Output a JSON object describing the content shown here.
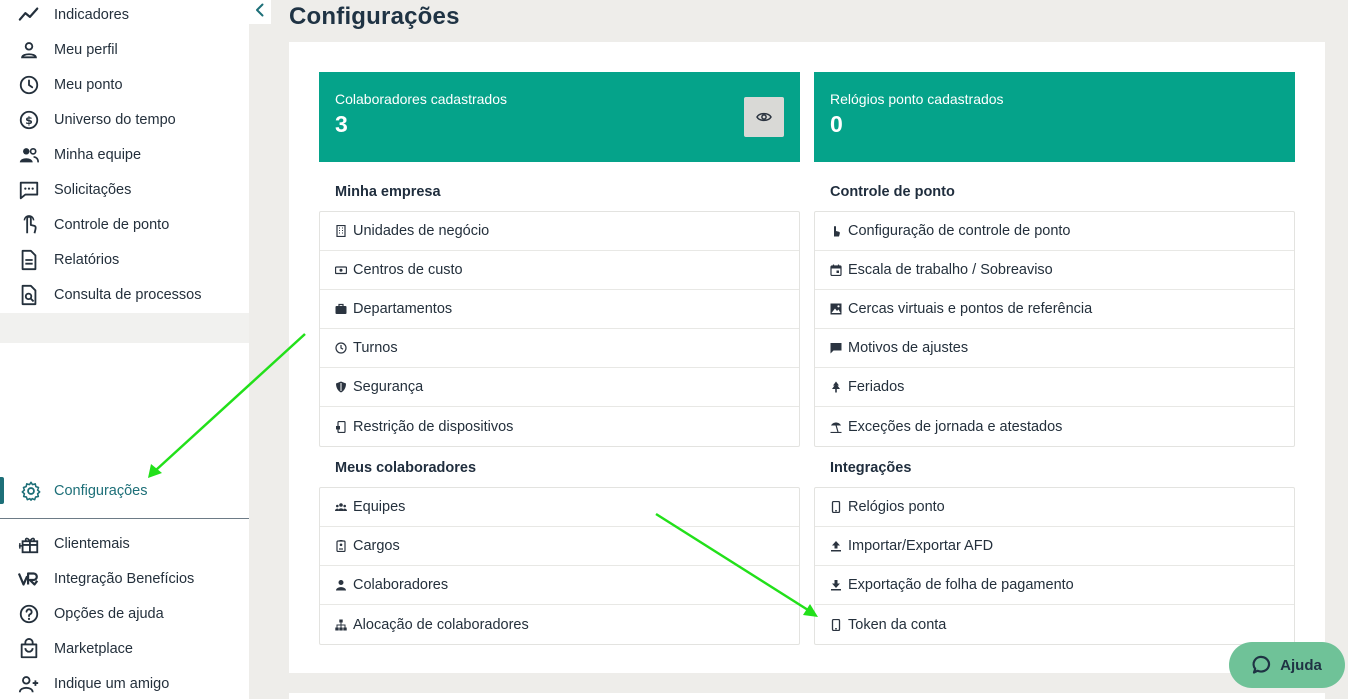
{
  "sidebar": {
    "items": [
      {
        "label": "Indicadores",
        "icon": "trend-icon"
      },
      {
        "label": "Meu perfil",
        "icon": "person-icon"
      },
      {
        "label": "Meu ponto",
        "icon": "clock-icon"
      },
      {
        "label": "Universo do tempo",
        "icon": "dollar-icon"
      },
      {
        "label": "Minha equipe",
        "icon": "team-icon"
      },
      {
        "label": "Solicitações",
        "icon": "chat-icon"
      },
      {
        "label": "Controle de ponto",
        "icon": "touch-icon"
      },
      {
        "label": "Relatórios",
        "icon": "document-icon"
      },
      {
        "label": "Consulta de processos",
        "icon": "search-document-icon"
      }
    ],
    "active_item": {
      "label": "Configurações",
      "icon": "gear-icon"
    },
    "bottom_items": [
      {
        "label": "Clientemais",
        "icon": "gift-icon"
      },
      {
        "label": "Integração Benefícios",
        "icon": "vr-icon"
      },
      {
        "label": "Opções de ajuda",
        "icon": "help-icon"
      },
      {
        "label": "Marketplace",
        "icon": "bag-icon"
      },
      {
        "label": "Indique um amigo",
        "icon": "add-person-icon"
      }
    ]
  },
  "page": {
    "title": "Configurações"
  },
  "stats": {
    "collaborators": {
      "label": "Colaboradores cadastrados",
      "value": "3"
    },
    "clocks": {
      "label": "Relógios ponto cadastrados",
      "value": "0"
    }
  },
  "sections": {
    "company": {
      "title": "Minha empresa",
      "items": [
        {
          "label": "Unidades de negócio",
          "icon": "building-icon"
        },
        {
          "label": "Centros de custo",
          "icon": "money-icon"
        },
        {
          "label": "Departamentos",
          "icon": "briefcase-icon"
        },
        {
          "label": "Turnos",
          "icon": "clock-icon"
        },
        {
          "label": "Segurança",
          "icon": "shield-icon"
        },
        {
          "label": "Restrição de dispositivos",
          "icon": "device-lock-icon"
        }
      ]
    },
    "timekeeping": {
      "title": "Controle de ponto",
      "items": [
        {
          "label": "Configuração de controle de ponto",
          "icon": "hand-pointer-icon"
        },
        {
          "label": "Escala de trabalho / Sobreaviso",
          "icon": "calendar-icon"
        },
        {
          "label": "Cercas virtuais e pontos de referência",
          "icon": "map-icon"
        },
        {
          "label": "Motivos de ajustes",
          "icon": "comment-icon"
        },
        {
          "label": "Feriados",
          "icon": "tree-icon"
        },
        {
          "label": "Exceções de jornada e atestados",
          "icon": "beach-icon"
        }
      ]
    },
    "collaborators": {
      "title": "Meus colaboradores",
      "items": [
        {
          "label": "Equipes",
          "icon": "group-icon"
        },
        {
          "label": "Cargos",
          "icon": "badge-icon"
        },
        {
          "label": "Colaboradores",
          "icon": "user-icon"
        },
        {
          "label": "Alocação de colaboradores",
          "icon": "sitemap-icon"
        }
      ]
    },
    "integrations": {
      "title": "Integrações",
      "items": [
        {
          "label": "Relógios ponto",
          "icon": "phone-icon"
        },
        {
          "label": "Importar/Exportar AFD",
          "icon": "upload-icon"
        },
        {
          "label": "Exportação de folha de pagamento",
          "icon": "download-icon"
        },
        {
          "label": "Token da conta",
          "icon": "phone-icon"
        }
      ]
    }
  },
  "help": {
    "label": "Ajuda"
  },
  "colors": {
    "accent": "#05a38a",
    "active_nav": "#1d6f78",
    "arrow": "#22e01a",
    "help_bg": "#6fc298"
  }
}
